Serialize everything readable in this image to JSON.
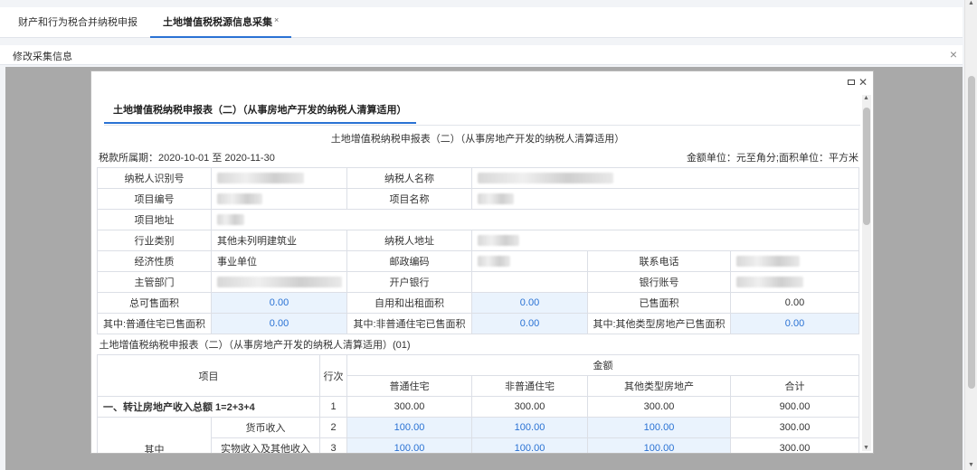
{
  "tabs": [
    {
      "label": "财产和行为税合并纳税申报"
    },
    {
      "label": "土地增值税税源信息采集",
      "close": "×"
    }
  ],
  "subhead": {
    "label": "修改采集信息",
    "close": "×"
  },
  "modal": {
    "tab": "土地增值税纳税申报表（二）（从事房地产开发的纳税人清算适用）",
    "form_title": "土地增值税纳税申报表（二）（从事房地产开发的纳税人清算适用）",
    "period": "税款所属期：2020-10-01 至 2020-11-30",
    "units": "金额单位：元至角分;面积单位：平方米",
    "info": {
      "taxpayer_id_label": "纳税人识别号",
      "taxpayer_name_label": "纳税人名称",
      "project_no_label": "项目编号",
      "project_name_label": "项目名称",
      "project_addr_label": "项目地址",
      "industry_label": "行业类别",
      "industry_value": "其他未列明建筑业",
      "taxpayer_addr_label": "纳税人地址",
      "nature_label": "经济性质",
      "nature_value": "事业单位",
      "postcode_label": "邮政编码",
      "phone_label": "联系电话",
      "authority_label": "主管部门",
      "bank_label": "开户银行",
      "account_label": "银行账号",
      "total_area_label": "总可售面积",
      "total_area_value": "0.00",
      "self_use_label": "自用和出租面积",
      "self_use_value": "0.00",
      "sold_label": "已售面积",
      "sold_value": "0.00",
      "ordinary_sold_label": "其中:普通住宅已售面积",
      "ordinary_sold_value": "0.00",
      "nonordinary_sold_label": "其中:非普通住宅已售面积",
      "nonordinary_sold_value": "0.00",
      "other_sold_label": "其中:其他类型房地产已售面积",
      "other_sold_value": "0.00"
    },
    "section_title": "土地增值税纳税申报表（二）（从事房地产开发的纳税人清算适用）(01)",
    "table": {
      "h_item": "项目",
      "h_row": "行次",
      "h_amount": "金额",
      "h_ordinary": "普通住宅",
      "h_nonordinary": "非普通住宅",
      "h_other": "其他类型房地产",
      "h_total": "合计",
      "rows": [
        {
          "item": "一、转让房地产收入总额 1=2+3+4",
          "row": "1",
          "ordinary": "300.00",
          "nonordinary": "300.00",
          "other": "300.00",
          "total": "900.00"
        },
        {
          "group": "其中",
          "item": "货币收入",
          "row": "2",
          "ordinary": "100.00",
          "nonordinary": "100.00",
          "other": "100.00",
          "total": "300.00"
        },
        {
          "item": "实物收入及其他收入",
          "row": "3",
          "ordinary": "100.00",
          "nonordinary": "100.00",
          "other": "100.00",
          "total": "300.00"
        }
      ]
    }
  }
}
